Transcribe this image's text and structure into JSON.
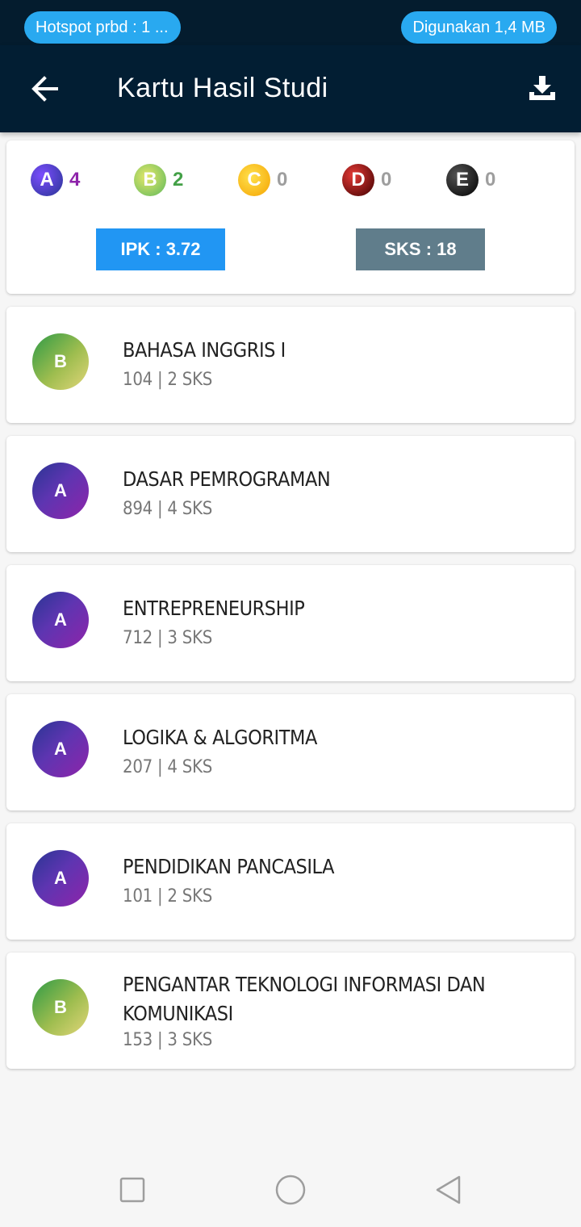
{
  "status_bar": {
    "hotspot": "Hotspot prbd : 1 ...",
    "usage": "Digunakan 1,4 MB"
  },
  "app_bar": {
    "title": "Kartu Hasil Studi",
    "back_icon": "arrow-left-icon",
    "download_icon": "download-icon"
  },
  "summary": {
    "grades": [
      {
        "letter": "A",
        "count": "4",
        "color": "#8e24aa"
      },
      {
        "letter": "B",
        "count": "2",
        "color": "#43a047"
      },
      {
        "letter": "C",
        "count": "0",
        "color": "#9e9e9e"
      },
      {
        "letter": "D",
        "count": "0",
        "color": "#9e9e9e"
      },
      {
        "letter": "E",
        "count": "0",
        "color": "#9e9e9e"
      }
    ],
    "ipk": "IPK : 3.72",
    "sks": "SKS : 18"
  },
  "courses": [
    {
      "grade": "B",
      "name": "BAHASA INGGRIS I",
      "meta": "104 | 2 SKS"
    },
    {
      "grade": "A",
      "name": "DASAR PEMROGRAMAN",
      "meta": "894 | 4 SKS"
    },
    {
      "grade": "A",
      "name": "ENTREPRENEURSHIP",
      "meta": "712 | 3 SKS"
    },
    {
      "grade": "A",
      "name": "LOGIKA & ALGORITMA",
      "meta": "207 | 4 SKS"
    },
    {
      "grade": "A",
      "name": "PENDIDIKAN PANCASILA",
      "meta": "101 | 2 SKS"
    },
    {
      "grade": "B",
      "name": "PENGANTAR TEKNOLOGI INFORMASI DAN KOMUNIKASI",
      "meta": "153 | 3 SKS"
    }
  ],
  "nav": {
    "recents_icon": "square-icon",
    "home_icon": "circle-icon",
    "back_icon": "triangle-back-icon"
  }
}
